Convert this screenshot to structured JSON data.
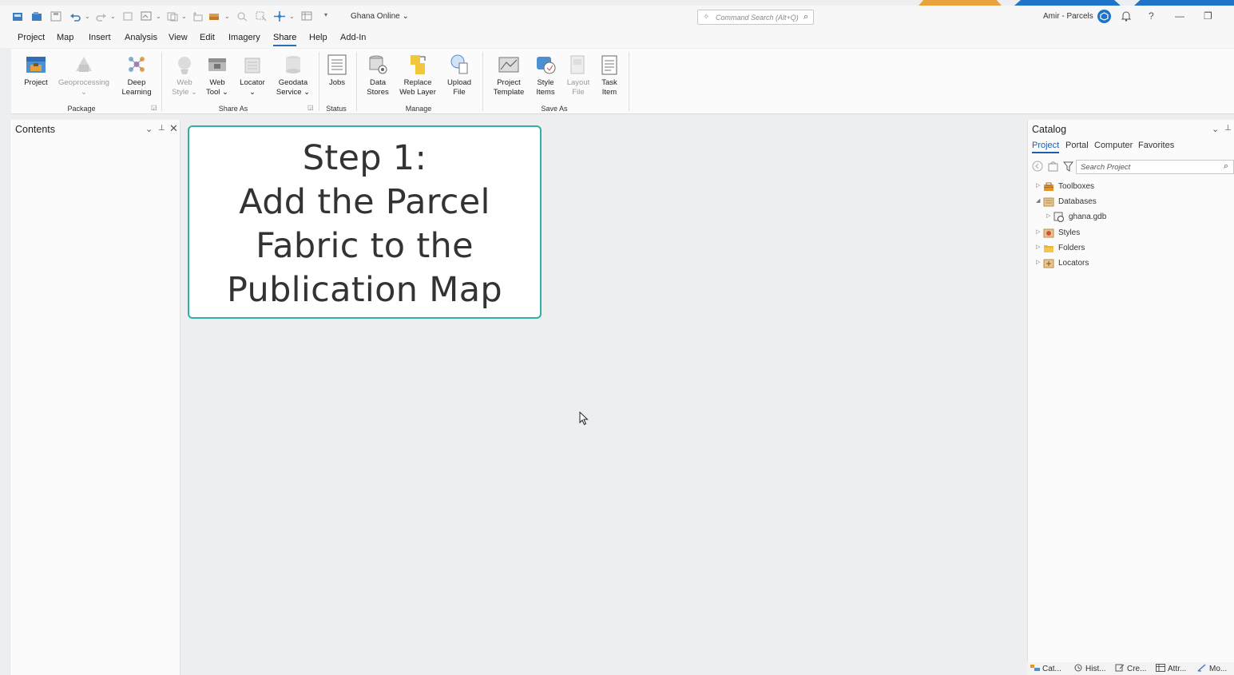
{
  "colors": {
    "accent": "#2d6fb7",
    "card_border": "#2fb0a4",
    "deco_orange": "#e8a43a",
    "deco_blue": "#1e74c8"
  },
  "titlebar": {
    "portal": "Ghana Online",
    "command_search_placeholder": "Command Search (Alt+Q)",
    "user": "Amir - Parcels",
    "help": "?",
    "minimize": "—",
    "restore": "❐"
  },
  "menu": {
    "items": [
      "Project",
      "Map",
      "Insert",
      "Analysis",
      "View",
      "Edit",
      "Imagery",
      "Share",
      "Help",
      "Add-In"
    ],
    "active": "Share"
  },
  "ribbon": {
    "groups": {
      "package": "Package",
      "share_as": "Share As",
      "status": "Status",
      "manage": "Manage",
      "save_as": "Save As"
    },
    "buttons": {
      "project": "Project",
      "geoprocessing": "Geoprocessing",
      "deep_learning": [
        "Deep",
        "Learning"
      ],
      "web_style": [
        "Web",
        "Style ⌄"
      ],
      "web_tool": [
        "Web",
        "Tool ⌄"
      ],
      "locator": [
        "Locator",
        "⌄"
      ],
      "geodata_service": [
        "Geodata",
        "Service ⌄"
      ],
      "jobs": "Jobs",
      "data_stores": [
        "Data",
        "Stores"
      ],
      "replace_web_layer": [
        "Replace",
        "Web Layer"
      ],
      "upload_file": [
        "Upload",
        "File"
      ],
      "project_template": [
        "Project",
        "Template"
      ],
      "style_items": [
        "Style",
        "Items"
      ],
      "layout_file": [
        "Layout",
        "File"
      ],
      "task_item": [
        "Task",
        "Item"
      ]
    }
  },
  "contents": {
    "title": "Contents"
  },
  "step_card": {
    "lines": [
      "Step 1:",
      "Add the Parcel",
      "Fabric to the",
      "Publication Map"
    ]
  },
  "catalog": {
    "title": "Catalog",
    "tabs": [
      "Project",
      "Portal",
      "Computer",
      "Favorites"
    ],
    "active_tab": "Project",
    "search_placeholder": "Search Project",
    "tree": [
      {
        "label": "Toolboxes",
        "expanded": false,
        "icon": "toolbox-icon"
      },
      {
        "label": "Databases",
        "expanded": true,
        "icon": "database-icon"
      },
      {
        "label": "ghana.gdb",
        "expanded": false,
        "icon": "geodatabase-icon"
      },
      {
        "label": "Styles",
        "expanded": false,
        "icon": "styles-icon"
      },
      {
        "label": "Folders",
        "expanded": false,
        "icon": "folder-icon"
      },
      {
        "label": "Locators",
        "expanded": false,
        "icon": "locator-icon"
      }
    ]
  },
  "bottom_tabs": [
    "Cat...",
    "Hist...",
    "Cre...",
    "Attr...",
    "Mo..."
  ]
}
